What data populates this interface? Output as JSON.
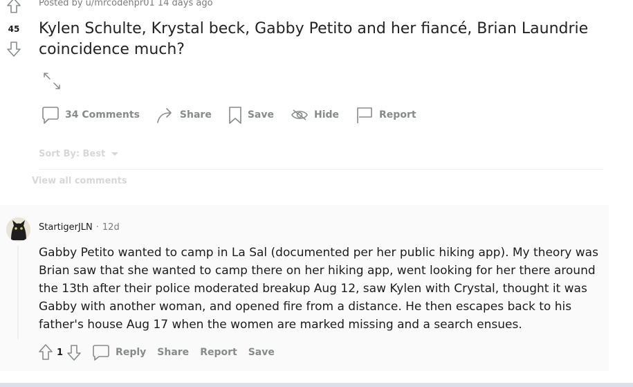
{
  "post": {
    "posted_by": "Posted by u/mrcodehpr01 14 days ago",
    "score": "45",
    "title": "Kylen Schulte, Krystal beck, Gabby Petito and her fiancé, Brian Laundrie coincidence much?",
    "actions": {
      "comments": "34 Comments",
      "share": "Share",
      "save": "Save",
      "hide": "Hide",
      "report": "Report"
    }
  },
  "sort": {
    "label": "Sort By: Best"
  },
  "view_all": "View all comments",
  "comment": {
    "author": "StartigerJLN",
    "separator": "·",
    "time": "12d",
    "body": "Gabby Petito wanted to camp in La Sal (documented per her public hiking app). My theory was Brian saw that she wanted to camp there on her hiking app, went looking for her there around the 13th after their police moderated breakup Aug 12, saw Kylen with Crystal, thought it was Gabby with another woman, and opened fire from a distance. He then escapes back to his father's house Aug 17 when the women are marked missing and a search ensues.",
    "score": "1",
    "actions": {
      "reply": "Reply",
      "share": "Share",
      "report": "Report",
      "save": "Save"
    }
  },
  "colors": {
    "icon_gray": "#878a8c",
    "muted_text": "#7c7c7c",
    "comment_bg": "#fafafa",
    "page_gutter": "#dae0e6"
  }
}
